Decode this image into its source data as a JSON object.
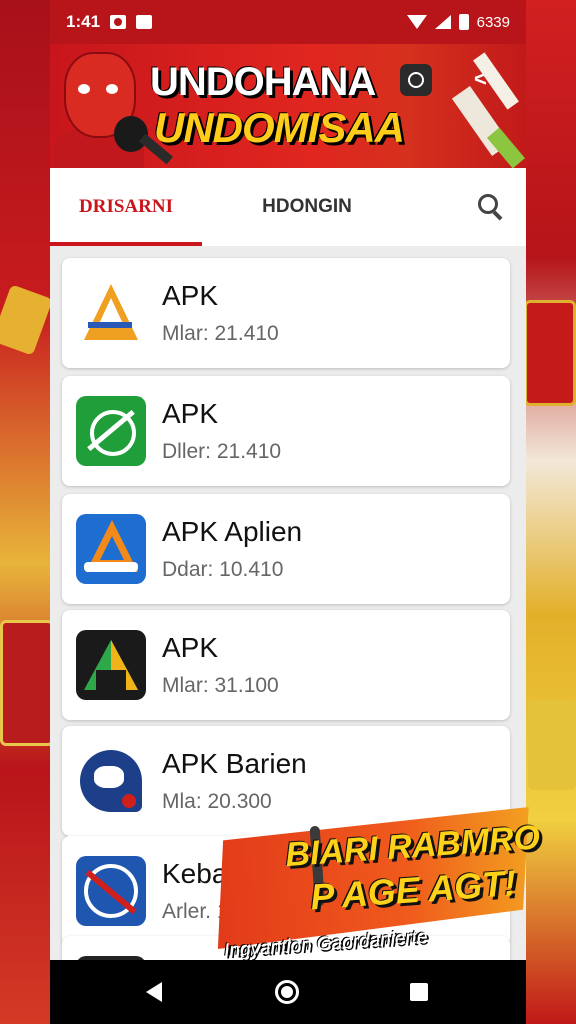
{
  "status_bar": {
    "time": "1:41",
    "battery_text": "6339"
  },
  "banner": {
    "title_line1": "UNDOHANA",
    "title_line2": "UNDOMISAA"
  },
  "tabs": [
    {
      "label": "DRISARNI",
      "active": true
    },
    {
      "label": "HDONGIN",
      "active": false
    }
  ],
  "apps": [
    {
      "title": "APK",
      "subtitle": "Mlar: 21.410",
      "icon": "apk-warning-triangle-icon"
    },
    {
      "title": "APK",
      "subtitle": "Dller: 21.410",
      "icon": "green-crossed-circle-icon"
    },
    {
      "title": "APK Aplien",
      "subtitle": "Ddar: 10.410",
      "icon": "blue-orange-a-icon"
    },
    {
      "title": "APK",
      "subtitle": "Mlar: 31.100",
      "icon": "green-yellow-triangle-icon"
    },
    {
      "title": "APK Barien",
      "subtitle": "Mla: 20.300",
      "icon": "blue-mascot-icon"
    },
    {
      "title": "Keback",
      "subtitle": "Arler. 1",
      "icon": "blue-no-entry-icon"
    }
  ],
  "promo": {
    "line1": "BIARI RABMRO",
    "line2": "P AGE AGT!",
    "tagline": "Ingyantion Gaordanierte"
  },
  "colors": {
    "brand_red": "#c8161c",
    "banner_yellow": "#ffcc1a",
    "list_bg": "#ececec"
  }
}
